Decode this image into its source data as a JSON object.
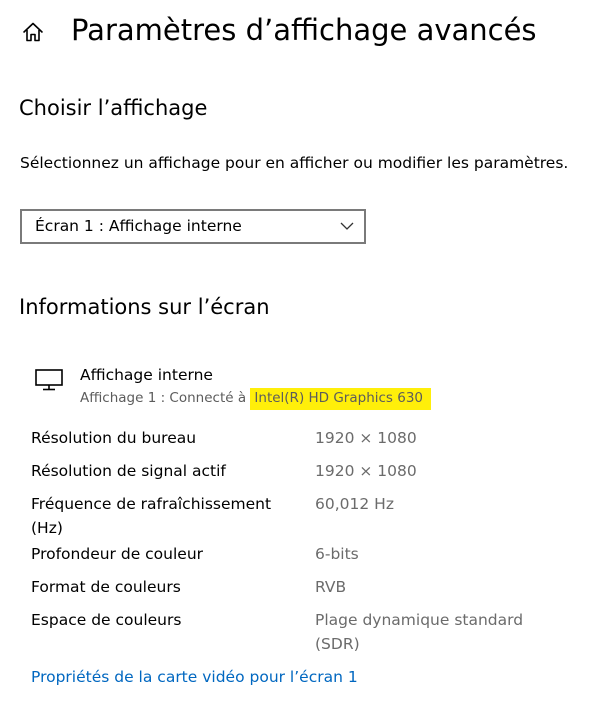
{
  "header": {
    "title": "Paramètres d’affichage avancés",
    "home_icon": "home-icon"
  },
  "choose_display": {
    "heading": "Choisir l’affichage",
    "description": "Sélectionnez un affichage pour en afficher ou modifier les paramètres.",
    "selected_display": "Écran 1 : Affichage interne"
  },
  "screen_info": {
    "heading": "Informations sur l’écran",
    "display_name": "Affichage interne",
    "connection_prefix": "Affichage 1 : Connecté à ",
    "adapter_name": "Intel(R) HD Graphics 630",
    "highlight_color": "#ffef0a",
    "rows": [
      {
        "label": "Résolution du bureau",
        "value": "1920 × 1080"
      },
      {
        "label": "Résolution de signal actif",
        "value": "1920 × 1080"
      },
      {
        "label": "Fréquence de rafraîchissement (Hz)",
        "value": "60,012 Hz"
      },
      {
        "label": "Profondeur de couleur",
        "value": "6-bits"
      },
      {
        "label": "Format de couleurs",
        "value": "RVB"
      },
      {
        "label": "Espace de couleurs",
        "value": "Plage dynamique standard (SDR)"
      }
    ],
    "adapter_link": "Propriétés de la carte vidéo pour l’écran 1",
    "link_color": "#0067c0"
  }
}
